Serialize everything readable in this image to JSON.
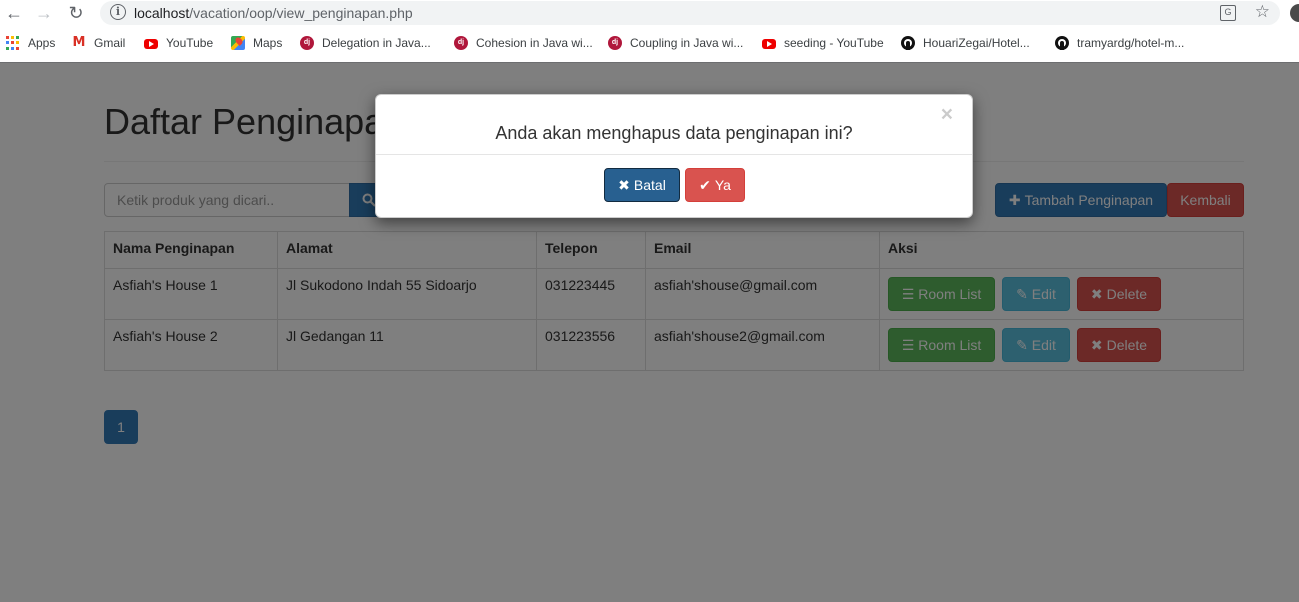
{
  "browser": {
    "url_host": "localhost",
    "url_path": "/vacation/oop/view_penginapan.php"
  },
  "bookmarks": [
    {
      "label": "Apps",
      "icon": "apps-icon"
    },
    {
      "label": "Gmail",
      "icon": "gmail-icon"
    },
    {
      "label": "YouTube",
      "icon": "youtube-icon"
    },
    {
      "label": "Maps",
      "icon": "maps-icon"
    },
    {
      "label": "Delegation in Java...",
      "icon": "django-icon"
    },
    {
      "label": "Cohesion in Java wi...",
      "icon": "django-icon"
    },
    {
      "label": "Coupling in Java wi...",
      "icon": "django-icon"
    },
    {
      "label": "seeding - YouTube",
      "icon": "youtube-icon"
    },
    {
      "label": "HouariZegai/Hotel...",
      "icon": "github-icon"
    },
    {
      "label": "tramyardg/hotel-m...",
      "icon": "github-icon"
    }
  ],
  "page": {
    "title": "Daftar Penginapan",
    "search_placeholder": "Ketik produk yang dicari..",
    "add_label": "Tambah Penginapan",
    "back_label": "Kembali"
  },
  "table": {
    "headers": [
      "Nama Penginapan",
      "Alamat",
      "Telepon",
      "Email",
      "Aksi"
    ],
    "rows": [
      {
        "nama": "Asfiah's House 1",
        "alamat": "Jl Sukodono Indah 55 Sidoarjo",
        "telepon": "031223445",
        "email": "asfiah'shouse@gmail.com"
      },
      {
        "nama": "Asfiah's House 2",
        "alamat": "Jl Gedangan 11",
        "telepon": "031223556",
        "email": "asfiah'shouse2@gmail.com"
      }
    ],
    "actions": {
      "room_list": "Room List",
      "edit": "Edit",
      "delete": "Delete"
    }
  },
  "pagination": {
    "current": "1"
  },
  "modal": {
    "close": "×",
    "title": "Anda akan menghapus data penginapan ini?",
    "cancel_label": "Batal",
    "confirm_label": "Ya"
  },
  "colors": {
    "primary": "#337ab7",
    "danger": "#d9534f",
    "success": "#5cb85c",
    "info": "#5bc0de"
  }
}
